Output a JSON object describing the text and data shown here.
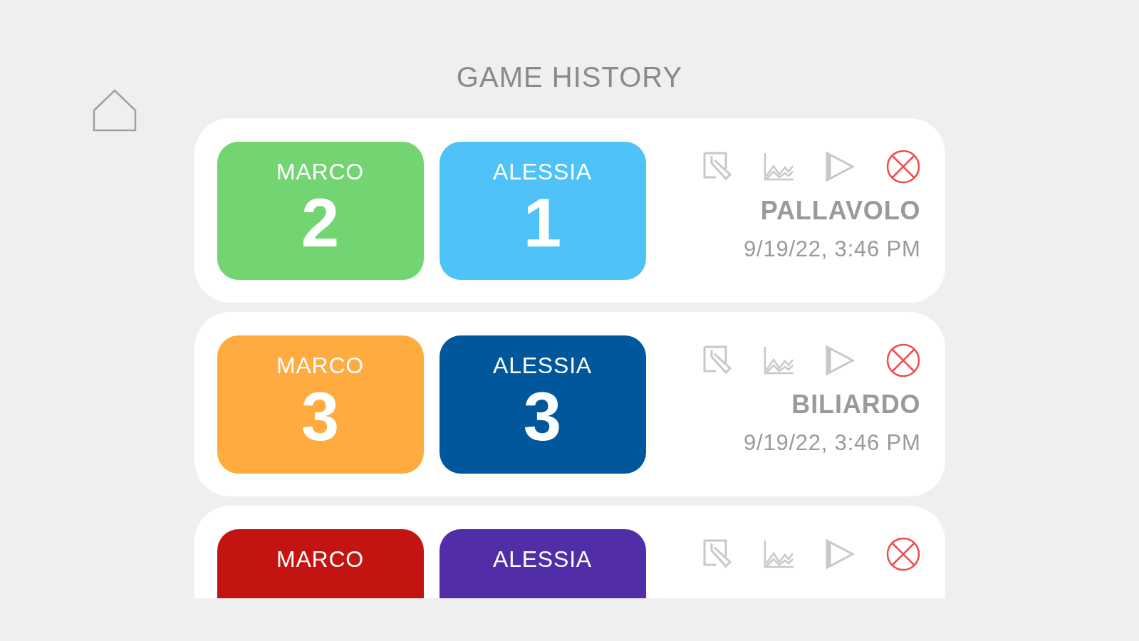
{
  "title": "GAME HISTORY",
  "games": [
    {
      "players": [
        {
          "name": "MARCO",
          "score": "2",
          "color": "#72d572"
        },
        {
          "name": "ALESSIA",
          "score": "1",
          "color": "#4fc3f7"
        }
      ],
      "game": "PALLAVOLO",
      "date": "9/19/22, 3:46 PM"
    },
    {
      "players": [
        {
          "name": "MARCO",
          "score": "3",
          "color": "#ffab40"
        },
        {
          "name": "ALESSIA",
          "score": "3",
          "color": "#01579b"
        }
      ],
      "game": "BILIARDO",
      "date": "9/19/22, 3:46 PM"
    },
    {
      "players": [
        {
          "name": "MARCO",
          "color": "#c41411"
        },
        {
          "name": "ALESSIA",
          "color": "#512da8"
        }
      ]
    }
  ]
}
